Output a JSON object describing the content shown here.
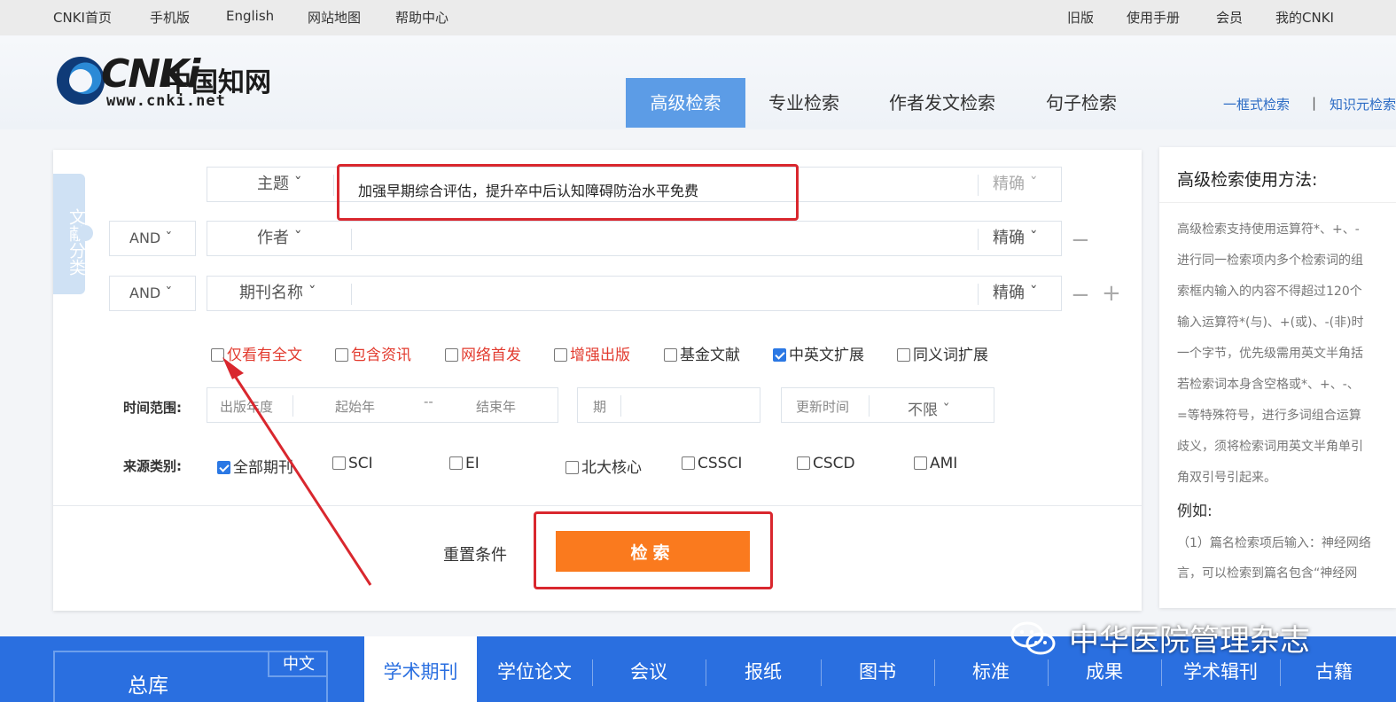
{
  "topbar": {
    "left": [
      "CNKI首页",
      "手机版",
      "English",
      "网站地图",
      "帮助中心"
    ],
    "right": [
      "旧版",
      "使用手册",
      "会员",
      "我的CNKI"
    ]
  },
  "logo": {
    "mark": "CNKi",
    "chinese": "中国知网",
    "url": "www.cnki.net"
  },
  "tabs": [
    "高级检索",
    "专业检索",
    "作者发文检索",
    "句子检索"
  ],
  "quick_links": [
    "一框式检索",
    "知识元检索"
  ],
  "quick_sep": "|",
  "class_tab": "文献分类",
  "rows": [
    {
      "op": "",
      "field": "主题 ˇ",
      "value": "加强早期综合评估，提升卒中后认知障碍防治水平免费",
      "match": "精确 ˇ"
    },
    {
      "op": "AND ˇ",
      "field": "作者 ˇ",
      "value": "",
      "match": "精确 ˇ"
    },
    {
      "op": "AND ˇ",
      "field": "期刊名称 ˇ",
      "value": "",
      "match": "精确 ˇ"
    }
  ],
  "minus": "−",
  "plus": "+",
  "checks": [
    {
      "label": "仅看有全文",
      "checked": false,
      "red": true
    },
    {
      "label": "包含资讯",
      "checked": false,
      "red": true
    },
    {
      "label": "网络首发",
      "checked": false,
      "red": true
    },
    {
      "label": "增强出版",
      "checked": false,
      "red": true
    },
    {
      "label": "基金文献",
      "checked": false,
      "red": false
    },
    {
      "label": "中英文扩展",
      "checked": true,
      "red": false
    },
    {
      "label": "同义词扩展",
      "checked": false,
      "red": false
    }
  ],
  "time": {
    "label": "时间范围:",
    "pub_year": "出版年度",
    "start": "起始年",
    "dash": "--",
    "end": "结束年",
    "issue": "期",
    "update_label": "更新时间",
    "update_value": "不限 ˇ"
  },
  "source": {
    "label": "来源类别:",
    "items": [
      {
        "label": "全部期刊",
        "checked": true
      },
      {
        "label": "SCI",
        "checked": false
      },
      {
        "label": "EI",
        "checked": false
      },
      {
        "label": "北大核心",
        "checked": false
      },
      {
        "label": "CSSCI",
        "checked": false
      },
      {
        "label": "CSCD",
        "checked": false
      },
      {
        "label": "AMI",
        "checked": false
      }
    ]
  },
  "buttons": {
    "reset": "重置条件",
    "search": "检索"
  },
  "help": {
    "title": "高级检索使用方法:",
    "lines": [
      "高级检索支持使用运算符*、+、-",
      "进行同一检索项内多个检索词的组",
      "索框内输入的内容不得超过120个",
      "输入运算符*(与)、+(或)、-(非)时",
      "一个字节，优先级需用英文半角括",
      "若检索词本身含空格或*、+、-、",
      "=等特殊符号，进行多词组合运算",
      "歧义，须将检索词用英文半角单引",
      "角双引号引起来。"
    ],
    "example_title": "例如:",
    "example_lines": [
      "（1）篇名检索项后输入：神经网络",
      "言，可以检索到篇名包含“神经网"
    ]
  },
  "bottom": {
    "zongku": "总库",
    "zhongwen": "中文",
    "items": [
      "学术期刊",
      "学位论文",
      "会议",
      "报纸",
      "图书",
      "标准",
      "成果",
      "学术辑刊",
      "古籍"
    ],
    "active_index": 0
  },
  "watermark": "中华医院管理杂志",
  "colors": {
    "accent": "#2a6fe0",
    "tab_active": "#5c9ce6",
    "search_button": "#fa7a1e",
    "highlight": "#d9272e",
    "red_option": "#e23a2e"
  }
}
